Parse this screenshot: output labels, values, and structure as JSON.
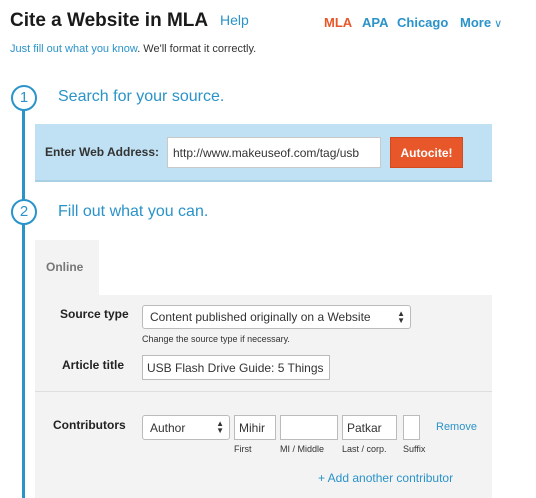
{
  "header": {
    "title": "Cite a Website in MLA",
    "help": "Help",
    "styles": {
      "mla": "MLA",
      "apa": "APA",
      "chicago": "Chicago",
      "more": "More"
    },
    "subtitle_link": "Just fill out what you know",
    "subtitle_rest": ". We'll format it correctly."
  },
  "steps": {
    "step1": {
      "number": "1",
      "title": "Search for your source."
    },
    "step2": {
      "number": "2",
      "title": "Fill out what you can."
    }
  },
  "autocite": {
    "label": "Enter Web Address:",
    "url_value": "http://www.makeuseof.com/tag/usb",
    "button": "Autocite!"
  },
  "form": {
    "tab": "Online",
    "source_type": {
      "label": "Source type",
      "selected": "Content published originally on a Website",
      "hint": "Change the source type if necessary."
    },
    "article_title": {
      "label": "Article title",
      "value": "USB Flash Drive Guide: 5 Things"
    },
    "contributors": {
      "label": "Contributors",
      "role_selected": "Author",
      "first_value": "Mihir",
      "middle_value": "",
      "last_value": "Patkar",
      "suffix_value": "",
      "first_label": "First",
      "middle_label": "MI / Middle",
      "last_label": "Last / corp.",
      "suffix_label": "Suffix",
      "remove": "Remove",
      "add": "+ Add another contributor"
    }
  },
  "colors": {
    "accent_blue": "#2a93c9",
    "accent_orange": "#e8572a",
    "panel_blue": "#bfe1f3",
    "form_gray": "#f3f3f3"
  }
}
